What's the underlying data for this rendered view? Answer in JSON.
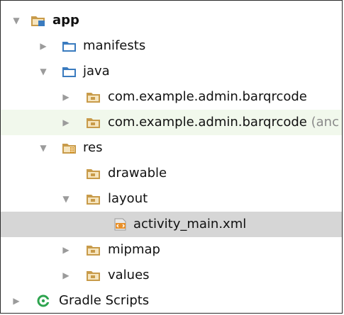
{
  "project_tree": {
    "app": {
      "label": "app",
      "expanded": true
    },
    "manifests": {
      "label": "manifests",
      "expanded": false
    },
    "java": {
      "label": "java",
      "expanded": true
    },
    "pkg_main": {
      "label": "com.example.admin.barqrcode",
      "expanded": false
    },
    "pkg_test": {
      "label": "com.example.admin.barqrcode",
      "suffix": "(anc",
      "expanded": false
    },
    "res": {
      "label": "res",
      "expanded": true
    },
    "drawable": {
      "label": "drawable"
    },
    "layout": {
      "label": "layout",
      "expanded": true
    },
    "activity_main": {
      "label": "activity_main.xml",
      "selected": true
    },
    "mipmap": {
      "label": "mipmap",
      "expanded": false
    },
    "values": {
      "label": "values",
      "expanded": false
    },
    "gradle": {
      "label": "Gradle Scripts",
      "expanded": false
    }
  },
  "icons": {
    "module": "module-folder-icon",
    "folder": "folder-icon",
    "package": "package-folder-icon",
    "resources": "resources-folder-icon",
    "xml_file": "xml-file-icon",
    "gradle": "gradle-icon"
  },
  "colors": {
    "folder_blue": "#3a7bbf",
    "folder_brown": "#c89b4a",
    "selection": "#d6d6d6",
    "row_highlight": "#f1f8ec",
    "gradle_green": "#2ea44f",
    "arrow_gray": "#9b9b9b"
  }
}
